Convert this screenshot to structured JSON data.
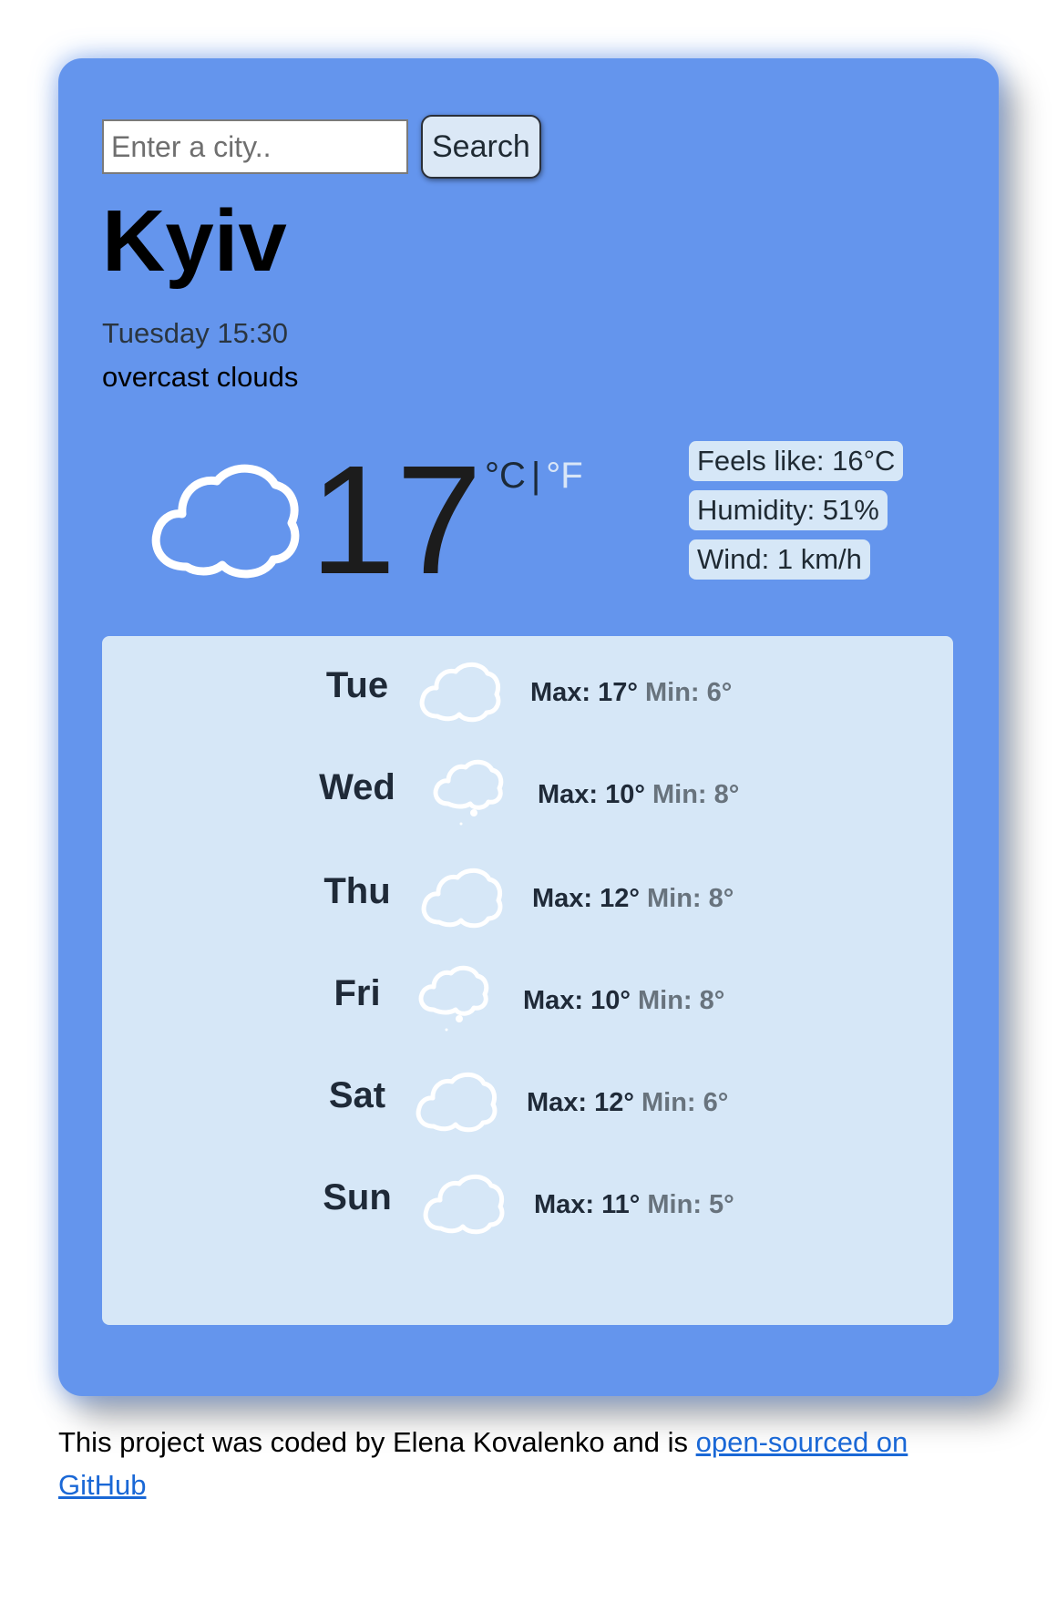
{
  "search": {
    "placeholder": "Enter a city..",
    "button_label": "Search"
  },
  "current": {
    "city": "Kyiv",
    "datetime": "Tuesday 15:30",
    "description": "overcast clouds",
    "icon": "cloud-icon",
    "temperature": "17",
    "unit_celsius": "°C",
    "unit_separator": "|",
    "unit_fahrenheit": "°F",
    "feels_like": "Feels like: 16°C",
    "humidity": "Humidity: 51%",
    "wind": "Wind: 1 km/h"
  },
  "forecast": [
    {
      "day": "Tue",
      "icon": "cloud-icon",
      "max": "Max: 17°",
      "min": "Min: 6°"
    },
    {
      "day": "Wed",
      "icon": "rain-cloud-icon",
      "max": "Max: 10°",
      "min": "Min: 8°"
    },
    {
      "day": "Thu",
      "icon": "cloud-icon",
      "max": "Max: 12°",
      "min": "Min: 8°"
    },
    {
      "day": "Fri",
      "icon": "rain-cloud-icon",
      "max": "Max: 10°",
      "min": "Min: 8°"
    },
    {
      "day": "Sat",
      "icon": "cloud-icon",
      "max": "Max: 12°",
      "min": "Min: 6°"
    },
    {
      "day": "Sun",
      "icon": "cloud-icon",
      "max": "Max: 11°",
      "min": "Min: 5°"
    }
  ],
  "footer": {
    "text": "This project was coded by Elena Kovalenko and is ",
    "link_text": "open-sourced on GitHub"
  },
  "colors": {
    "card_background": "#6495ed",
    "forecast_background": "#d6e7f7",
    "link": "#1a68d6"
  }
}
